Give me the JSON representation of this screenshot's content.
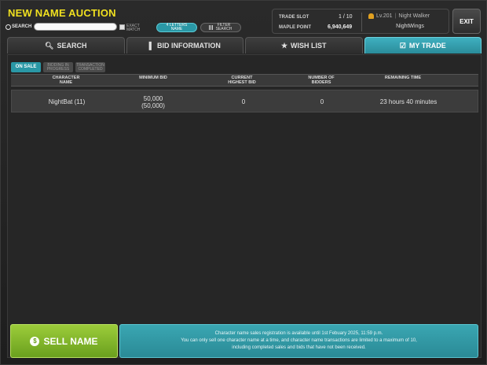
{
  "header": {
    "title": "NEW NAME AUCTION",
    "search_label": "SEARCH",
    "search_value": "",
    "exact_match_label": "EXACT MATCH",
    "four_letters_label": "4 LETTERS NAME",
    "filter_search_label": "FILTER SEARCH"
  },
  "account": {
    "trade_slot_label": "TRADE SLOT",
    "trade_slot_value": "1 / 10",
    "maple_point_label": "MAPLE POINT",
    "maple_point_value": "6,940,649",
    "level_text": "Lv.201",
    "job_text": "Night Walker",
    "guild": "NightWings"
  },
  "exit_label": "EXIT",
  "tabs": [
    {
      "label": "SEARCH",
      "icon": "search-icon",
      "active": false
    },
    {
      "label": "BID INFORMATION",
      "icon": "chart-icon",
      "active": false
    },
    {
      "label": "WISH LIST",
      "icon": "star-icon",
      "active": false
    },
    {
      "label": "MY TRADE",
      "icon": "check-icon",
      "active": true
    }
  ],
  "subtabs": [
    {
      "label": "ON SALE",
      "active": true
    },
    {
      "label": "BIDDING IN PROGRESS",
      "active": false
    },
    {
      "label": "TRANSACTION COMPLETED",
      "active": false
    }
  ],
  "table": {
    "columns": [
      "CHARACTER NAME",
      "MINIMUM BID",
      "CURRENT HIGHEST BID",
      "NUMBER OF BIDDERS",
      "REMAINING TIME"
    ],
    "rows": [
      {
        "name": "NightBat (11)",
        "min_bid": "50,000",
        "min_bid_sub": "(50,000)",
        "highest_bid": "0",
        "bidders": "0",
        "remaining": "23 hours 40 minutes"
      }
    ]
  },
  "sell_button_label": "SELL NAME",
  "notice": {
    "line1": "Character name sales registration is available until 1st Febuary 2025, 11:59 p.m.",
    "line2": "You can only sell one character name at a time, and character name transactions are limited to a maximum of 10,",
    "line3": "including completed sales and bids that have not been received."
  },
  "colors": {
    "accent_teal": "#2a98a6",
    "title_yellow": "#f0e020",
    "sell_green": "#7fb62a"
  }
}
